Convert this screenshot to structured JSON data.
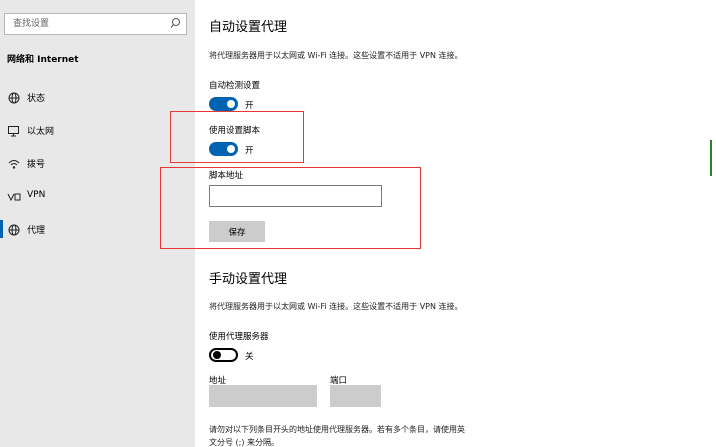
{
  "sidebar": {
    "search_placeholder": "查找设置",
    "section_title": "网络和 Internet",
    "items": [
      {
        "label": "状态",
        "icon": "status-globe-icon"
      },
      {
        "label": "以太网",
        "icon": "ethernet-monitor-icon"
      },
      {
        "label": "拨号",
        "icon": "dialup-icon"
      },
      {
        "label": "VPN",
        "icon": "vpn-icon"
      },
      {
        "label": "代理",
        "icon": "proxy-globe-icon",
        "active": true
      }
    ]
  },
  "auto": {
    "title": "自动设置代理",
    "desc": "将代理服务器用于以太网或 Wi-Fi 连接。这些设置不适用于 VPN 连接。",
    "detect_label": "自动检测设置",
    "detect_state": "开",
    "script_label": "使用设置脚本",
    "script_state": "开",
    "address_label": "脚本地址",
    "address_value": "",
    "save_label": "保存"
  },
  "manual": {
    "title": "手动设置代理",
    "desc": "将代理服务器用于以太网或 Wi-Fi 连接。这些设置不适用于 VPN 连接。",
    "use_label": "使用代理服务器",
    "use_state": "关",
    "address_label": "地址",
    "port_label": "端口",
    "note_line1": "请勿对以下列条目开头的地址使用代理服务器。若有多个条目，请使用英",
    "note_line2": "文分号 (;) 来分隔。"
  },
  "colors": {
    "accent": "#0063b1",
    "highlight_box": "#e53935",
    "sidebar_bg": "#e8e8e8"
  }
}
